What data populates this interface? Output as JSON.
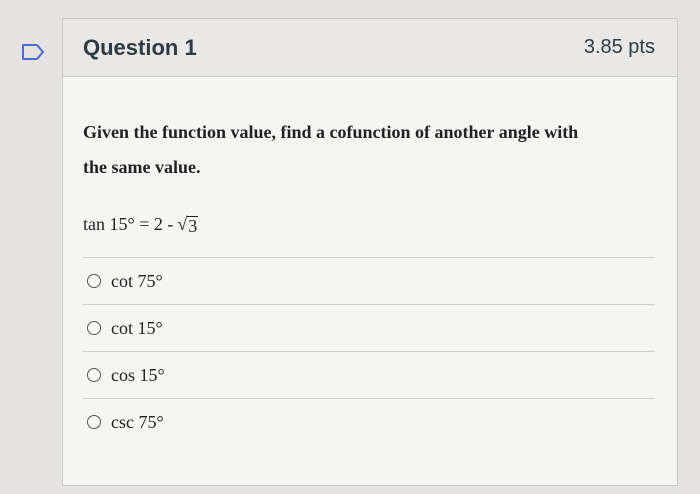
{
  "question": {
    "title": "Question 1",
    "points": "3.85 pts",
    "prompt": "Given the function value, find a cofunction of another angle with the same value.",
    "equation_left": "tan 15° = 2 - ",
    "equation_radicand": "3"
  },
  "answers": [
    {
      "label": "cot 75°"
    },
    {
      "label": "cot 15°"
    },
    {
      "label": "cos 15°"
    },
    {
      "label": "csc 75°"
    }
  ],
  "colors": {
    "bookmark_stroke": "#4a6cd4",
    "header_bg": "#e9e8e6",
    "card_bg": "#f5f5f3"
  },
  "icons": {
    "bookmark": "bookmark-icon",
    "radio": "radio-unselected"
  }
}
